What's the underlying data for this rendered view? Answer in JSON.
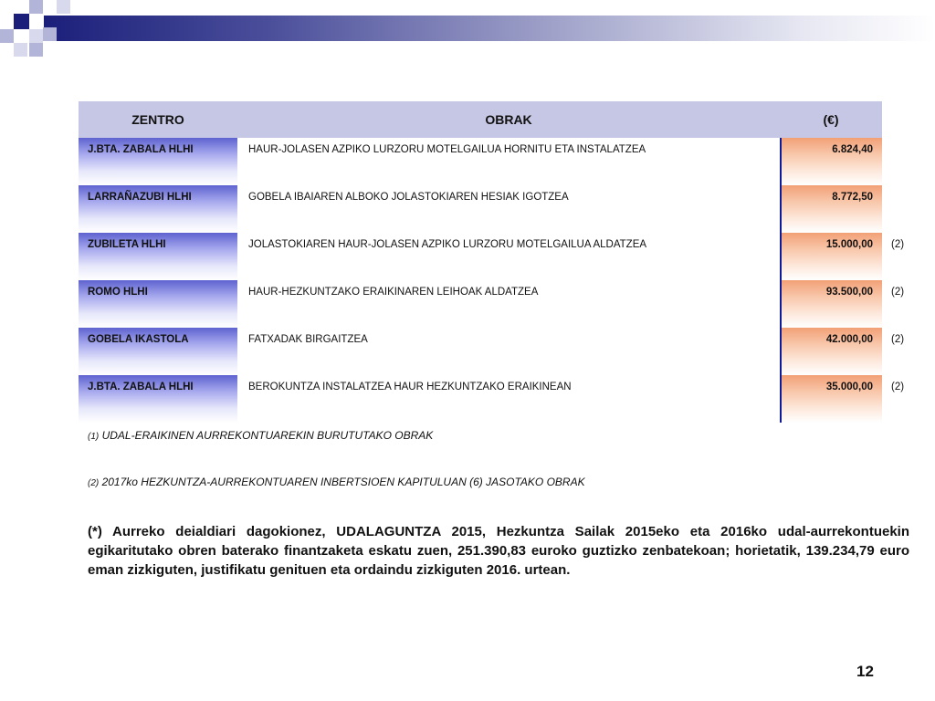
{
  "table": {
    "headers": {
      "zentro": "ZENTRO",
      "obrak": "OBRAK",
      "euro": "(€)"
    },
    "rows": [
      {
        "zentro": "J.BTA. ZABALA HLHI",
        "obrak": "HAUR-JOLASEN AZPIKO LURZORU MOTELGAILUA HORNITU ETA INSTALATZEA",
        "euro": "6.824,40",
        "note": ""
      },
      {
        "zentro": "LARRAÑAZUBI HLHI",
        "obrak": "GOBELA IBAIAREN ALBOKO JOLASTOKIAREN HESIAK IGOTZEA",
        "euro": "8.772,50",
        "note": ""
      },
      {
        "zentro": "ZUBILETA HLHI",
        "obrak": "JOLASTOKIAREN HAUR-JOLASEN AZPIKO LURZORU MOTELGAILUA ALDATZEA",
        "euro": "15.000,00",
        "note": "(2)"
      },
      {
        "zentro": "ROMO HLHI",
        "obrak": "HAUR-HEZKUNTZAKO ERAIKINAREN LEIHOAK ALDATZEA",
        "euro": "93.500,00",
        "note": "(2)"
      },
      {
        "zentro": "GOBELA IKASTOLA",
        "obrak": "FATXADAK BIRGAITZEA",
        "euro": "42.000,00",
        "note": "(2)"
      },
      {
        "zentro": "J.BTA. ZABALA HLHI",
        "obrak": "BEROKUNTZA INSTALATZEA HAUR HEZKUNTZAKO ERAIKINEAN",
        "euro": "35.000,00",
        "note": "(2)"
      }
    ]
  },
  "footnotes": [
    {
      "num": "(1)",
      "text": "UDAL-ERAIKINEN AURREKONTUAREKIN BURUTUTAKO OBRAK"
    },
    {
      "num": "(2)",
      "text": "2017ko HEZKUNTZA-AURREKONTUAREN INBERTSIOEN KAPITULUAN (6) JASOTAKO OBRAK"
    }
  ],
  "paragraph": "(*) Aurreko deialdiari dagokionez, UDALAGUNTZA 2015, Hezkuntza Sailak 2015eko eta 2016ko udal-aurrekontuekin egikaritutako obren baterako finantzaketa eskatu zuen, 251.390,83 euroko guztizko zenbatekoan; horietatik, 139.234,79 euro eman zizkiguten, justifikatu genituen eta ordaindu zizkiguten 2016. urtean.",
  "page_number": "12",
  "colors": {
    "header_navy": "#1b1f7a",
    "table_header": "#c6c7e4",
    "zentro_fill": "#5e62cf",
    "euro_fill": "#f2a076"
  }
}
